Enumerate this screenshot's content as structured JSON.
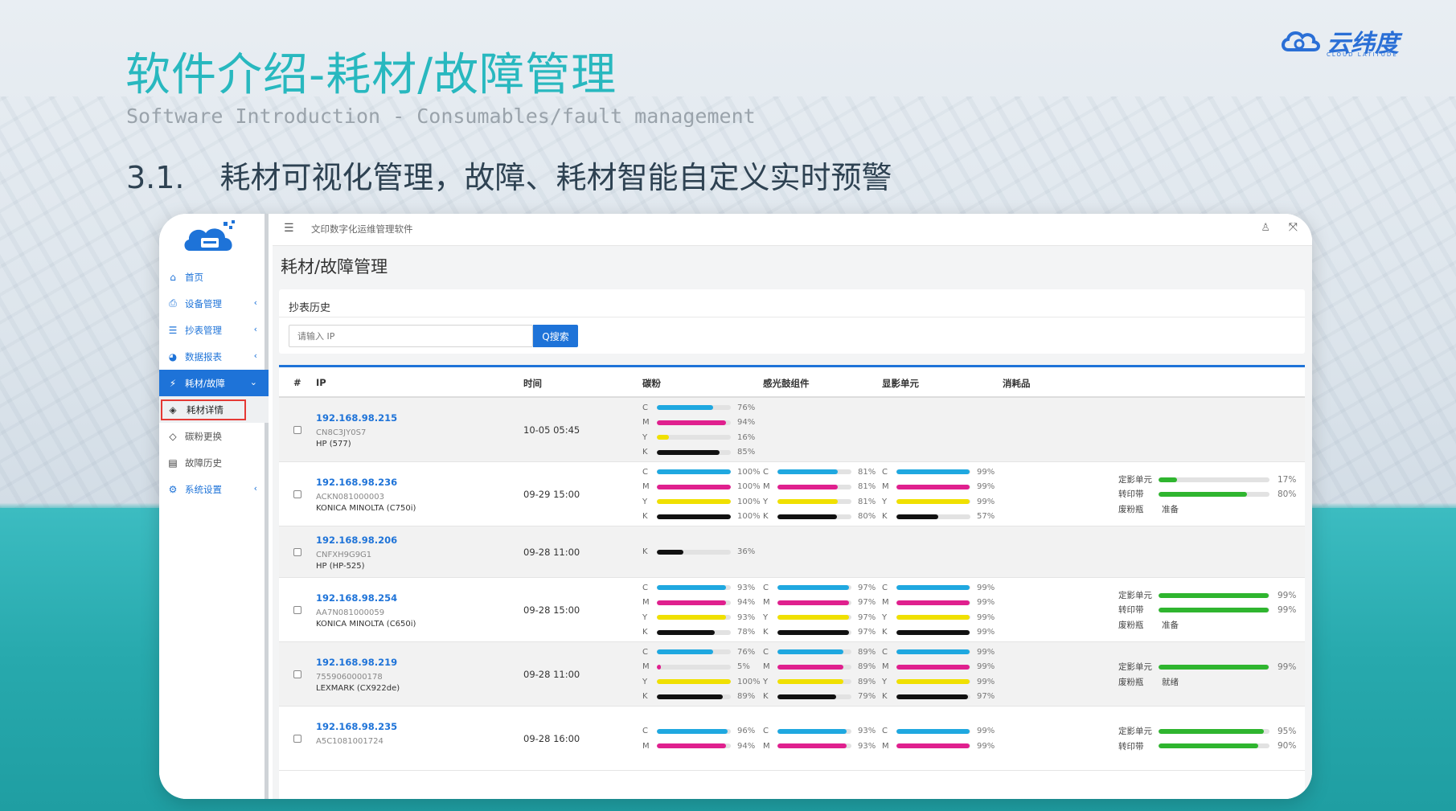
{
  "slide": {
    "title": "软件介绍-耗材/故障管理",
    "subtitle": "Software Introduction - Consumables/fault management",
    "heading_num": "3.1.",
    "heading_text": "耗材可视化管理，故障、耗材智能自定义实时预警",
    "logo_text": "云纬度",
    "logo_sub": "CLOUD LATITUDE"
  },
  "colors": {
    "accent": "#1e73d8",
    "title": "#28b8bf",
    "cyan": "#1fa8e0",
    "magenta": "#e0208e",
    "yellow": "#f0e000",
    "black": "#111111",
    "green": "#2fb52f",
    "highlight": "#e53935"
  },
  "topbar": {
    "app_name": "文印数字化运维管理软件",
    "menu_icon": "hamburger-icon",
    "user_icon": "user-icon",
    "fullscreen_icon": "fullscreen-icon"
  },
  "sidebar": {
    "items": [
      {
        "label": "首页",
        "icon": "home-icon",
        "glyph": "⌂",
        "chevron": ""
      },
      {
        "label": "设备管理",
        "icon": "printer-icon",
        "glyph": "⎙",
        "chevron": "‹"
      },
      {
        "label": "抄表管理",
        "icon": "list-icon",
        "glyph": "☰",
        "chevron": "‹"
      },
      {
        "label": "数据报表",
        "icon": "pie-chart-icon",
        "glyph": "◕",
        "chevron": "‹"
      },
      {
        "label": "耗材/故障",
        "icon": "plug-icon",
        "glyph": "⚡",
        "chevron": "⌄"
      }
    ],
    "sub_items": [
      {
        "label": "耗材详情",
        "icon": "fill-icon",
        "glyph": "◈"
      },
      {
        "label": "碳粉更换",
        "icon": "paint-bucket-icon",
        "glyph": "◇"
      },
      {
        "label": "故障历史",
        "icon": "server-icon",
        "glyph": "▤"
      }
    ],
    "last_item": {
      "label": "系统设置",
      "icon": "settings-icon",
      "glyph": "⚙",
      "chevron": "‹"
    }
  },
  "page": {
    "title": "耗材/故障管理"
  },
  "filter": {
    "card_title": "抄表历史",
    "search_placeholder": "请输入 IP",
    "search_button": "Q搜索"
  },
  "table": {
    "headers": [
      "#",
      "IP",
      "时间",
      "碳粉",
      "感光鼓组件",
      "显影单元",
      "消耗品"
    ],
    "rows": [
      {
        "ip": "192.168.98.215",
        "sn": "CN8C3JY0S7",
        "model": "HP (577)",
        "time": "10-05 05:45",
        "toner": [
          [
            "C",
            76
          ],
          [
            "M",
            94
          ],
          [
            "Y",
            16
          ],
          [
            "K",
            85
          ]
        ],
        "drum": [],
        "dev": [],
        "cons": []
      },
      {
        "ip": "192.168.98.236",
        "sn": "ACKN081000003",
        "model": "KONICA MINOLTA (C750i)",
        "time": "09-29 15:00",
        "toner": [
          [
            "C",
            100
          ],
          [
            "M",
            100
          ],
          [
            "Y",
            100
          ],
          [
            "K",
            100
          ]
        ],
        "drum": [
          [
            "C",
            81
          ],
          [
            "M",
            81
          ],
          [
            "Y",
            81
          ],
          [
            "K",
            80
          ]
        ],
        "dev": [
          [
            "C",
            99
          ],
          [
            "M",
            99
          ],
          [
            "Y",
            99
          ],
          [
            "K",
            57
          ]
        ],
        "cons": [
          {
            "name": "定影单元",
            "value": 17
          },
          {
            "name": "转印带",
            "value": 80
          },
          {
            "name": "废粉瓶",
            "status": "准备"
          }
        ]
      },
      {
        "ip": "192.168.98.206",
        "sn": "CNFXH9G9G1",
        "model": "HP (HP-525)",
        "time": "09-28 11:00",
        "toner": [
          [
            "K",
            36
          ]
        ],
        "drum": [],
        "dev": [],
        "cons": []
      },
      {
        "ip": "192.168.98.254",
        "sn": "AA7N081000059",
        "model": "KONICA MINOLTA (C650i)",
        "time": "09-28 15:00",
        "toner": [
          [
            "C",
            93
          ],
          [
            "M",
            94
          ],
          [
            "Y",
            93
          ],
          [
            "K",
            78
          ]
        ],
        "drum": [
          [
            "C",
            97
          ],
          [
            "M",
            97
          ],
          [
            "Y",
            97
          ],
          [
            "K",
            97
          ]
        ],
        "dev": [
          [
            "C",
            99
          ],
          [
            "M",
            99
          ],
          [
            "Y",
            99
          ],
          [
            "K",
            99
          ]
        ],
        "cons": [
          {
            "name": "定影单元",
            "value": 99
          },
          {
            "name": "转印带",
            "value": 99
          },
          {
            "name": "废粉瓶",
            "status": "准备"
          }
        ]
      },
      {
        "ip": "192.168.98.219",
        "sn": "7559060000178",
        "model": "LEXMARK (CX922de)",
        "time": "09-28 11:00",
        "toner": [
          [
            "C",
            76
          ],
          [
            "M",
            5
          ],
          [
            "Y",
            100
          ],
          [
            "K",
            89
          ]
        ],
        "drum": [
          [
            "C",
            89
          ],
          [
            "M",
            89
          ],
          [
            "Y",
            89
          ],
          [
            "K",
            79
          ]
        ],
        "dev": [
          [
            "C",
            99
          ],
          [
            "M",
            99
          ],
          [
            "Y",
            99
          ],
          [
            "K",
            97
          ]
        ],
        "cons": [
          {
            "name": "定影单元",
            "value": 99
          },
          {
            "name": "废粉瓶",
            "status": "就绪"
          }
        ]
      },
      {
        "ip": "192.168.98.235",
        "sn": "A5C1081001724",
        "model": "",
        "time": "09-28 16:00",
        "toner": [
          [
            "C",
            96
          ],
          [
            "M",
            94
          ]
        ],
        "drum": [
          [
            "C",
            93
          ],
          [
            "M",
            93
          ]
        ],
        "dev": [
          [
            "C",
            99
          ],
          [
            "M",
            99
          ]
        ],
        "cons": [
          {
            "name": "定影单元",
            "value": 95
          },
          {
            "name": "转印带",
            "value": 90
          }
        ]
      }
    ]
  }
}
